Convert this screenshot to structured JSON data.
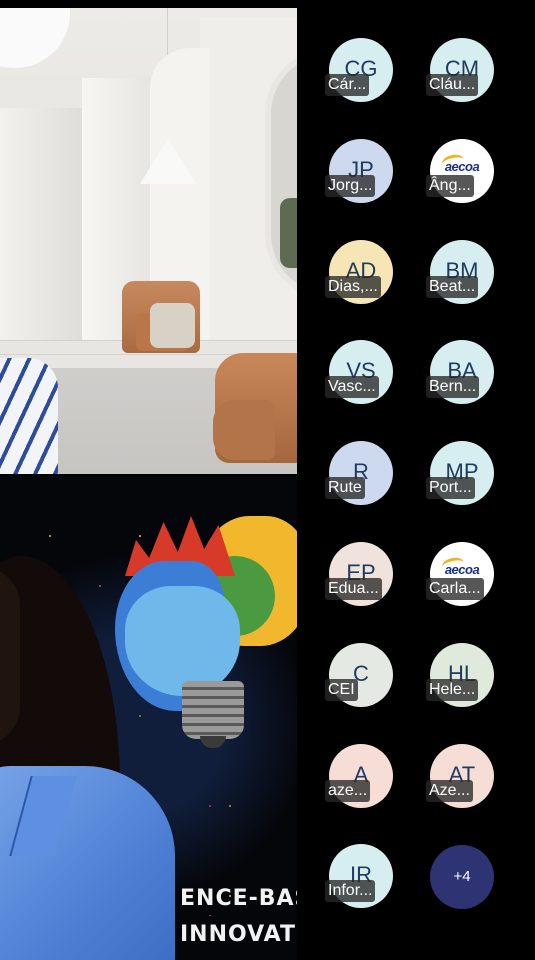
{
  "poster": {
    "line1": "ENCE-BAS",
    "line2": "INNOVAT"
  },
  "participants": [
    {
      "initials": "CG",
      "name": "Cár...",
      "bg": "#d7eef0",
      "type": "initials"
    },
    {
      "initials": "CM",
      "name": "Cláu...",
      "bg": "#d7eef0",
      "type": "initials"
    },
    {
      "initials": "JP",
      "name": "Jorg...",
      "bg": "#cdd9ef",
      "type": "initials"
    },
    {
      "initials": "",
      "name": "Âng...",
      "bg": "#ffffff",
      "type": "logo",
      "logo_text": "aecoa"
    },
    {
      "initials": "AD",
      "name": "Dias,...",
      "bg": "#f7e6b5",
      "type": "initials"
    },
    {
      "initials": "BM",
      "name": "Beat...",
      "bg": "#d7eef0",
      "type": "initials"
    },
    {
      "initials": "VS",
      "name": "Vasc...",
      "bg": "#d7eef0",
      "type": "initials"
    },
    {
      "initials": "BA",
      "name": "Bern...",
      "bg": "#d7eef0",
      "type": "initials"
    },
    {
      "initials": "R",
      "name": "Rute",
      "bg": "#cdd9ef",
      "type": "initials"
    },
    {
      "initials": "MP",
      "name": "Port...",
      "bg": "#d7eef0",
      "type": "initials"
    },
    {
      "initials": "EP",
      "name": "Edua...",
      "bg": "#f0e2dc",
      "type": "initials"
    },
    {
      "initials": "",
      "name": "Carla...",
      "bg": "#ffffff",
      "type": "logo",
      "logo_text": "aecoa"
    },
    {
      "initials": "C",
      "name": "CEI",
      "bg": "#e4e9e4",
      "type": "initials"
    },
    {
      "initials": "HL",
      "name": "Hele...",
      "bg": "#dfeadc",
      "type": "initials"
    },
    {
      "initials": "A",
      "name": "aze...",
      "bg": "#f6ddd6",
      "type": "initials"
    },
    {
      "initials": "AT",
      "name": "Aze...",
      "bg": "#f6ddd6",
      "type": "initials"
    },
    {
      "initials": "IR",
      "name": "Infor...",
      "bg": "#d7eef0",
      "type": "initials"
    }
  ],
  "overflow": {
    "label": "+4",
    "bg": "#2e3373"
  },
  "colors": {
    "panel_bg": "#000000",
    "initials_text": "#1f3b5e"
  }
}
